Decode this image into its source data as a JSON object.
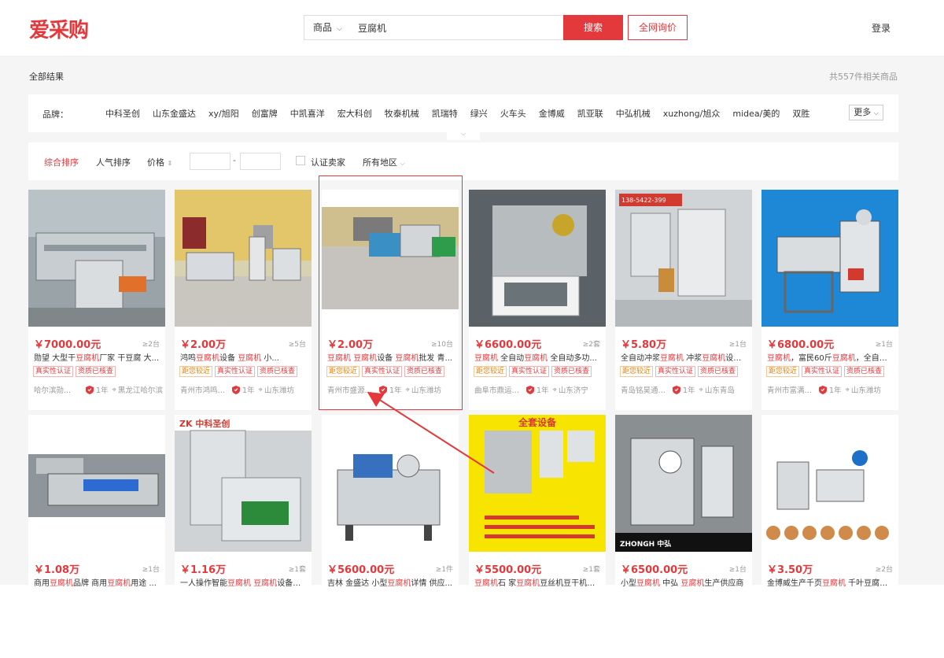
{
  "header": {
    "logo": "爱采购",
    "search_category": "商品",
    "search_query": "豆腐机",
    "search_button": "搜索",
    "inquiry_button": "全网询价",
    "login": "登录"
  },
  "breadcrumb": "全部结果",
  "result_count": "共557件相关商品",
  "brands": {
    "label": "品牌：",
    "items": [
      "中科圣创",
      "山东金盛达",
      "xy/旭阳",
      "创富牌",
      "中凯喜洋",
      "宏大科创",
      "牧泰机械",
      "凯瑞特",
      "绿兴",
      "火车头",
      "金博威",
      "凯亚联",
      "中弘机械",
      "xuzhong/旭众",
      "midea/美的",
      "双胜"
    ],
    "more": "更多"
  },
  "filters": {
    "sort_default": "综合排序",
    "sort_popular": "人气排序",
    "price": "价格",
    "price_dash": "-",
    "certified": "认证卖家",
    "region": "所有地区"
  },
  "products": [
    {
      "price": "￥7000.00元",
      "moq": "≥2台",
      "title_parts": [
        "勋望 大型干",
        "豆腐机",
        "厂家 干豆腐 大..."
      ],
      "tags": [
        "真实性认证",
        "资质已核查"
      ],
      "company": "哈尔滨勋...",
      "years": "1年",
      "region": "黑龙江哈尔滨"
    },
    {
      "price": "￥2.00万",
      "moq": "≥5台",
      "title_parts": [
        "鸿鸣",
        "豆腐机",
        "设备 ",
        "豆腐机",
        " 小..."
      ],
      "tags": [
        "距您较近",
        "真实性认证",
        "资质已核查"
      ],
      "company": "青州市鸿鸣豆...",
      "years": "1年",
      "region": "山东潍坊"
    },
    {
      "price": "￥2.00万",
      "moq": "≥10台",
      "title_parts": [
        "豆腐机",
        " ",
        "豆腐机",
        "设备 ",
        "豆腐机",
        "批发 青..."
      ],
      "tags": [
        "距您较近",
        "真实性认证",
        "资质已核查"
      ],
      "company": "青州市盛源机...",
      "years": "1年",
      "region": "山东潍坊"
    },
    {
      "price": "￥6600.00元",
      "moq": "≥2套",
      "title_parts": [
        "豆腐机",
        " 全自动",
        "豆腐机",
        " 全自动多功..."
      ],
      "tags": [
        "距您较近",
        "真实性认证",
        "资质已核查"
      ],
      "company": "曲阜市鼎运食...",
      "years": "1年",
      "region": "山东济宁"
    },
    {
      "price": "￥5.80万",
      "moq": "≥1台",
      "title_parts": [
        "全自动冲浆",
        "豆腐机",
        " 冲浆",
        "豆腐机",
        "设备..."
      ],
      "tags": [
        "距您较近",
        "真实性认证",
        "资质已核查"
      ],
      "company": "青岛铭昊通机...",
      "years": "1年",
      "region": "山东青岛"
    },
    {
      "price": "￥6800.00元",
      "moq": "≥1台",
      "title_parts": [
        "豆腐机",
        "，富民60斤",
        "豆腐机",
        "，全自动..."
      ],
      "tags": [
        "距您较近",
        "真实性认证",
        "资质已核查"
      ],
      "company": "青州市富满合...",
      "years": "1年",
      "region": "山东潍坊"
    },
    {
      "price": "￥1.08万",
      "moq": "≥1台",
      "title_parts": [
        "商用",
        "豆腐机",
        "品牌 商用",
        "豆腐机",
        "用途 ..."
      ]
    },
    {
      "price": "￥1.16万",
      "moq": "≥1套",
      "title_parts": [
        "一人操作智能",
        "豆腐机",
        " ",
        "豆腐机",
        "设备价..."
      ]
    },
    {
      "price": "￥5600.00元",
      "moq": "≥1件",
      "title_parts": [
        "吉林 金盛达 小型",
        "豆腐机",
        "详情 供应..."
      ]
    },
    {
      "price": "￥5500.00元",
      "moq": "≥1套",
      "title_parts": [
        "豆腐机",
        "石 家",
        "豆腐机",
        "豆丝机豆干机压..."
      ]
    },
    {
      "price": "￥6500.00元",
      "moq": "≥1台",
      "title_parts": [
        "小型",
        "豆腐机",
        " 中弘 ",
        "豆腐机",
        "生产供应商"
      ]
    },
    {
      "price": "￥3.50万",
      "moq": "≥2台",
      "title_parts": [
        "金博威生产千页",
        "豆腐机",
        " 千叶豆腐新..."
      ]
    }
  ],
  "image_text": {
    "zk": "中科圣创",
    "quanjia": "全套设备",
    "zhonghong": "ZHONGH 中弘",
    "phone": "138-5422-399"
  },
  "colors": {
    "accent": "#e4393c",
    "orange": "#f08200"
  }
}
